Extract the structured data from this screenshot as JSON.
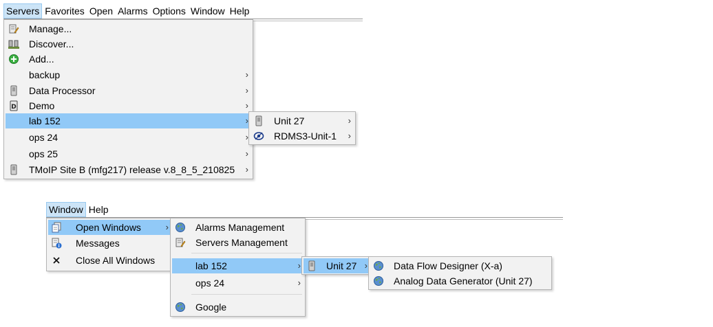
{
  "menubar_top": {
    "items": [
      "Servers",
      "Favorites",
      "Open",
      "Alarms",
      "Options",
      "Window",
      "Help"
    ]
  },
  "servers_menu": {
    "items": [
      {
        "label": "Manage...",
        "icon": "server-manage-icon"
      },
      {
        "label": "Discover...",
        "icon": "discover-icon"
      },
      {
        "label": "Add...",
        "icon": "add-circle-icon"
      },
      {
        "label": "backup",
        "icon": ""
      },
      {
        "label": "Data Processor",
        "icon": "server-icon"
      },
      {
        "label": "Demo",
        "icon": "demo-icon"
      },
      {
        "label": "lab 152",
        "icon": ""
      },
      {
        "label": "ops 24",
        "icon": ""
      },
      {
        "label": "ops 25",
        "icon": ""
      },
      {
        "label": "TMoIP Site B (mfg217) release v.8_8_5_210825",
        "icon": "server-icon"
      }
    ]
  },
  "lab_submenu": {
    "items": [
      {
        "label": "Unit 27",
        "icon": "server-icon"
      },
      {
        "label": "RDMS3-Unit-1",
        "icon": "rdms-icon"
      }
    ]
  },
  "menubar_bottom": {
    "items": [
      "Window",
      "Help"
    ]
  },
  "window_menu": {
    "items": [
      {
        "label": "Open Windows",
        "icon": "windows-icon"
      },
      {
        "label": "Messages",
        "icon": "messages-icon"
      },
      {
        "label": "Close All Windows",
        "icon": "close-icon"
      }
    ]
  },
  "open_windows_submenu": {
    "items": [
      {
        "label": "Alarms Management",
        "icon": "globe-icon"
      },
      {
        "label": "Servers Management",
        "icon": "server-manage-icon"
      },
      {
        "label": "lab 152",
        "icon": ""
      },
      {
        "label": "ops 24",
        "icon": ""
      },
      {
        "label": "Google",
        "icon": "globe-icon"
      }
    ]
  },
  "lab152_submenu": {
    "items": [
      {
        "label": "Unit 27",
        "icon": "server-icon"
      }
    ]
  },
  "unit27_submenu": {
    "items": [
      {
        "label": "Data Flow Designer (X-a)",
        "icon": "globe-icon"
      },
      {
        "label": "Analog Data Generator (Unit 27)",
        "icon": "globe-icon"
      }
    ]
  },
  "submenu_arrow": "›",
  "colors": {
    "highlight": "#91c9f7",
    "menubar_active": "#cce4f7",
    "menu_bg": "#f2f2f2"
  }
}
